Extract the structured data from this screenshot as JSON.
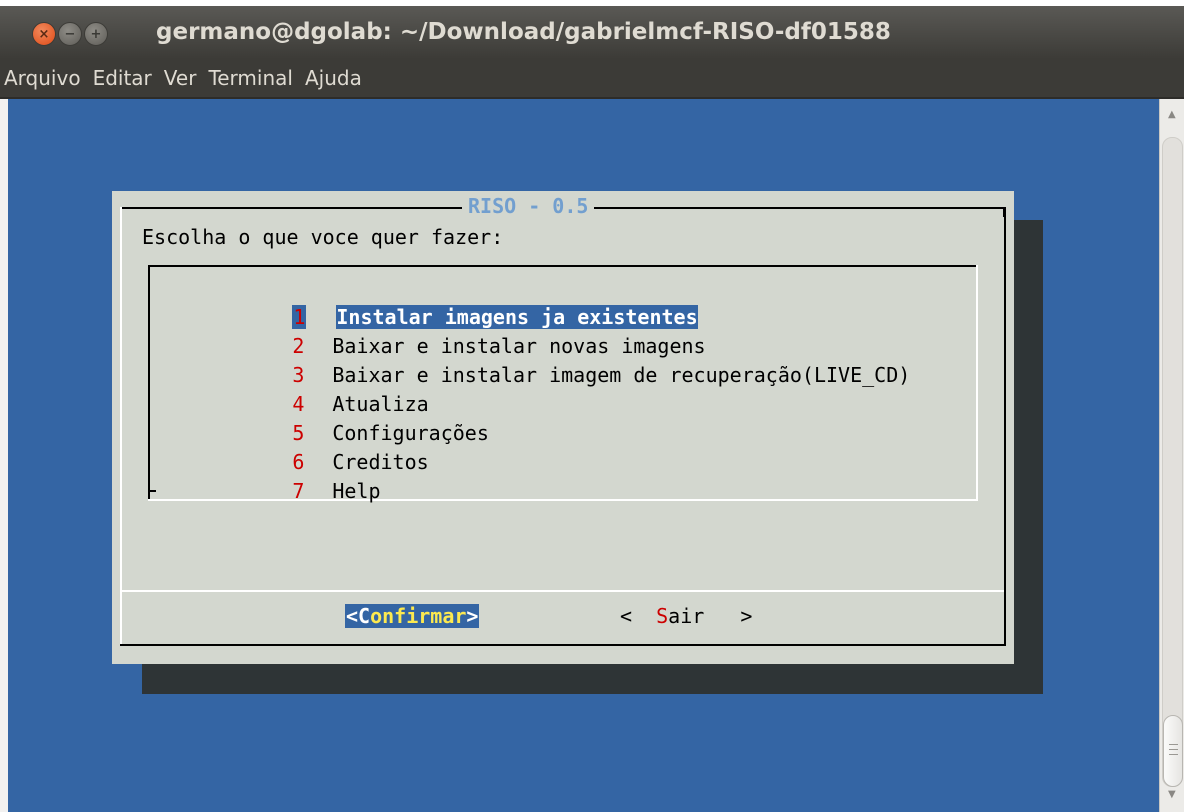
{
  "window": {
    "title": "germano@dgolab: ~/Download/gabrielmcf-RISO-df01588",
    "close_glyph": "×",
    "minimize_glyph": "−",
    "maximize_glyph": "+"
  },
  "menubar": {
    "items": [
      "Arquivo",
      "Editar",
      "Ver",
      "Terminal",
      "Ajuda"
    ]
  },
  "dialog": {
    "title": "RISO - 0.5",
    "prompt": "Escolha o que voce quer fazer:",
    "selected_index": 0,
    "items": [
      {
        "num": "1",
        "label": "Instalar imagens ja existentes"
      },
      {
        "num": "2",
        "label": "Baixar e instalar novas imagens"
      },
      {
        "num": "3",
        "label": "Baixar e instalar imagem de recuperação(LIVE_CD)"
      },
      {
        "num": "4",
        "label": "Atualiza"
      },
      {
        "num": "5",
        "label": "Configurações"
      },
      {
        "num": "6",
        "label": "Creditos"
      },
      {
        "num": "7",
        "label": "Help"
      }
    ],
    "buttons": {
      "confirm": {
        "open": "<",
        "hotkey": "C",
        "rest": "onfirmar",
        "close": ">"
      },
      "exit": {
        "open": "<  ",
        "hotkey": "S",
        "rest": "air",
        "close": "   >"
      }
    }
  },
  "scrollbar": {
    "up_icon": "▲",
    "down_icon": "▼",
    "position": 1.0
  },
  "colors": {
    "terminal_bg": "#3465a4",
    "dialog_bg": "#d3d7cf",
    "title_color": "#729fcf",
    "hotkey_red": "#cc0000",
    "confirm_text": "#fce94f",
    "window_chrome": "#3c3b37",
    "close_button": "#df4a16"
  }
}
